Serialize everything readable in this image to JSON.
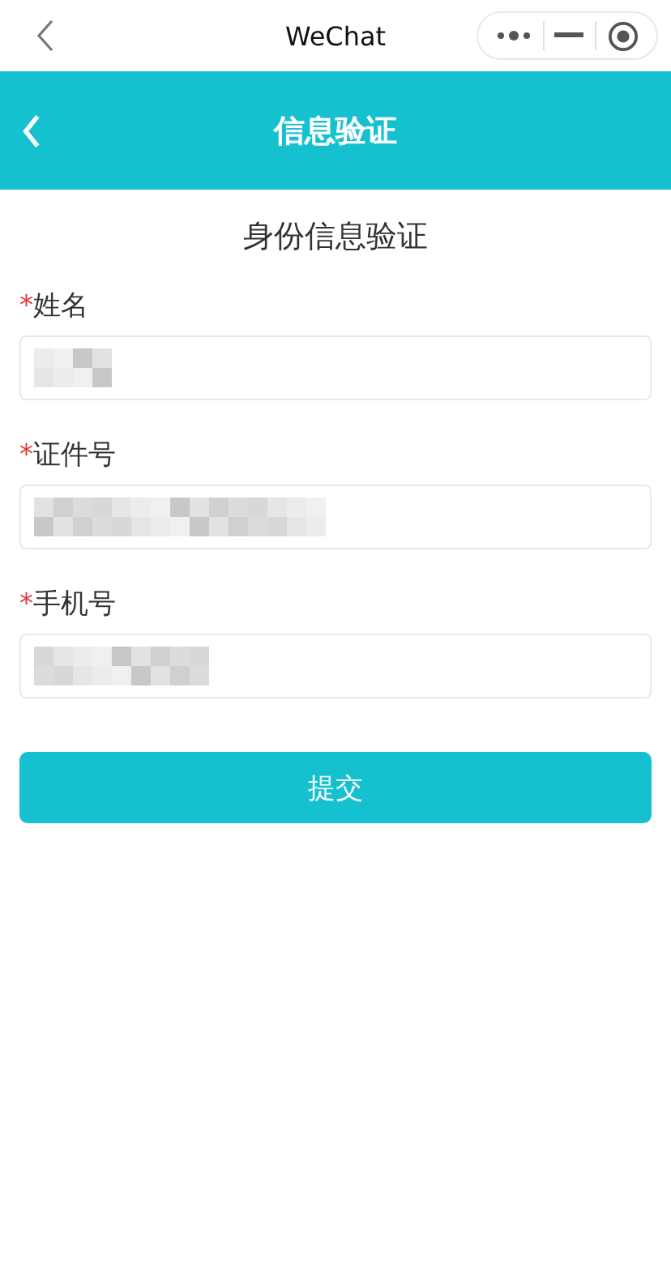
{
  "wechat_bar": {
    "title": "WeChat"
  },
  "header": {
    "title": "信息验证"
  },
  "form": {
    "heading": "身份信息验证",
    "fields": [
      {
        "required_mark": "*",
        "label": "姓名",
        "kind": "name",
        "masked": true
      },
      {
        "required_mark": "*",
        "label": "证件号",
        "kind": "id",
        "masked": true
      },
      {
        "required_mark": "*",
        "label": "手机号",
        "kind": "phone",
        "masked": true
      }
    ],
    "submit": "提交"
  }
}
